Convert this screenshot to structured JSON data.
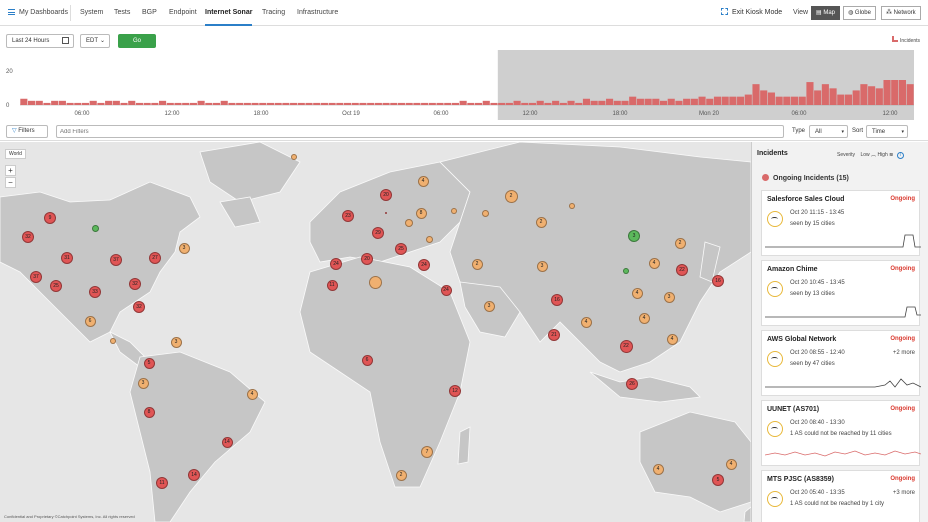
{
  "nav": {
    "dashboards": "My Dashboards",
    "tabs": [
      "System",
      "Tests",
      "BGP",
      "Endpoint",
      "Internet Sonar",
      "Tracing",
      "Infrastructure"
    ],
    "active": "Internet Sonar",
    "exit_kiosk": "Exit Kiosk Mode",
    "view_label": "View",
    "views": [
      "Map",
      "Globe",
      "Network"
    ],
    "selected_view": "Map"
  },
  "controls": {
    "range": "Last 24 Hours",
    "tz": "EDT",
    "go": "Go"
  },
  "histogram": {
    "legend": "Incidents",
    "y_ticks": [
      "20",
      "0"
    ],
    "x_ticks": [
      "06:00",
      "12:00",
      "18:00",
      "Oct 19",
      "06:00",
      "12:00",
      "18:00",
      "Mon 20",
      "06:00",
      "12:00"
    ],
    "values": [
      3,
      2,
      2,
      1,
      2,
      2,
      1,
      1,
      1,
      2,
      1,
      2,
      2,
      1,
      2,
      1,
      1,
      1,
      2,
      1,
      1,
      1,
      1,
      2,
      1,
      1,
      2,
      1,
      1,
      1,
      1,
      1,
      1,
      1,
      1,
      1,
      1,
      1,
      1,
      1,
      1,
      1,
      1,
      1,
      1,
      1,
      1,
      1,
      1,
      1,
      1,
      1,
      1,
      1,
      1,
      1,
      1,
      2,
      1,
      1,
      2,
      1,
      1,
      1,
      2,
      1,
      1,
      2,
      1,
      2,
      1,
      2,
      1,
      3,
      2,
      2,
      3,
      2,
      2,
      4,
      3,
      3,
      3,
      2,
      3,
      2,
      3,
      3,
      4,
      3,
      4,
      4,
      4,
      4,
      5,
      10,
      7,
      6,
      4,
      4,
      4,
      4,
      11,
      7,
      10,
      8,
      5,
      5,
      7,
      10,
      9,
      8,
      12,
      12,
      12,
      10
    ],
    "selected_from_index": 62
  },
  "filterbar": {
    "filters_btn": "Filters",
    "add_filters_placeholder": "Add Filters",
    "type_label": "Type",
    "type_value": "All",
    "sort_label": "Sort",
    "sort_value": "Time"
  },
  "map": {
    "world_label": "World",
    "zoom_in": "+",
    "zoom_out": "−",
    "markers": [
      {
        "v": "9",
        "c": "red"
      },
      {
        "v": "32",
        "c": "red"
      },
      {
        "v": "37",
        "c": "red"
      },
      {
        "v": "31",
        "c": "red"
      },
      {
        "v": "37",
        "c": "red"
      },
      {
        "v": "27",
        "c": "red"
      },
      {
        "v": "3",
        "c": "orange"
      },
      {
        "v": "25",
        "c": "red"
      },
      {
        "v": "33",
        "c": "red"
      },
      {
        "v": "32",
        "c": "red"
      },
      {
        "v": "32",
        "c": "red"
      },
      {
        "v": "6",
        "c": "orange"
      },
      {
        "v": "",
        "c": "green"
      },
      {
        "v": "",
        "c": "orange"
      },
      {
        "v": "3",
        "c": "orange"
      },
      {
        "v": "5",
        "c": "red"
      },
      {
        "v": "3",
        "c": "orange"
      },
      {
        "v": "8",
        "c": "red"
      },
      {
        "v": "4",
        "c": "orange"
      },
      {
        "v": "14",
        "c": "red"
      },
      {
        "v": "14",
        "c": "red"
      },
      {
        "v": "11",
        "c": "red"
      },
      {
        "v": "",
        "c": "orange"
      },
      {
        "v": "20",
        "c": "red"
      },
      {
        "v": "4",
        "c": "orange"
      },
      {
        "v": "23",
        "c": "red"
      },
      {
        "v": "",
        "c": "red"
      },
      {
        "v": "8",
        "c": "orange"
      },
      {
        "v": "",
        "c": "orange"
      },
      {
        "v": "",
        "c": "orange"
      },
      {
        "v": "29",
        "c": "red"
      },
      {
        "v": "",
        "c": "orange"
      },
      {
        "v": "25",
        "c": "red"
      },
      {
        "v": "24",
        "c": "red"
      },
      {
        "v": "20",
        "c": "red"
      },
      {
        "v": "24",
        "c": "red"
      },
      {
        "v": "11",
        "c": "red"
      },
      {
        "v": "",
        "c": "orange"
      },
      {
        "v": "2",
        "c": "orange"
      },
      {
        "v": "",
        "c": "orange"
      },
      {
        "v": "2",
        "c": "orange"
      },
      {
        "v": "",
        "c": "orange"
      },
      {
        "v": "2",
        "c": "orange"
      },
      {
        "v": "3",
        "c": "green"
      },
      {
        "v": "2",
        "c": "orange"
      },
      {
        "v": "3",
        "c": "orange"
      },
      {
        "v": "24",
        "c": "red"
      },
      {
        "v": "3",
        "c": "orange"
      },
      {
        "v": "16",
        "c": "red"
      },
      {
        "v": "21",
        "c": "red"
      },
      {
        "v": "4",
        "c": "orange"
      },
      {
        "v": "",
        "c": "green"
      },
      {
        "v": "4",
        "c": "orange"
      },
      {
        "v": "22",
        "c": "red"
      },
      {
        "v": "16",
        "c": "red"
      },
      {
        "v": "4",
        "c": "orange"
      },
      {
        "v": "3",
        "c": "orange"
      },
      {
        "v": "4",
        "c": "orange"
      },
      {
        "v": "4",
        "c": "orange"
      },
      {
        "v": "22",
        "c": "red"
      },
      {
        "v": "26",
        "c": "red"
      },
      {
        "v": "6",
        "c": "red"
      },
      {
        "v": "12",
        "c": "red"
      },
      {
        "v": "7",
        "c": "orange"
      },
      {
        "v": "2",
        "c": "orange"
      },
      {
        "v": "4",
        "c": "orange"
      },
      {
        "v": "5",
        "c": "red"
      },
      {
        "v": "4",
        "c": "orange"
      }
    ]
  },
  "panel": {
    "title": "Incidents",
    "severity_label": "Severity",
    "low": "Low",
    "high": "High",
    "ongoing_header": "Ongoing Incidents (15)",
    "cards": [
      {
        "title": "Salesforce Sales Cloud",
        "status": "Ongoing",
        "time": "Oct 20 11:15 - 13:45",
        "seen": "seen by 15 cities",
        "more": ""
      },
      {
        "title": "Amazon Chime",
        "status": "Ongoing",
        "time": "Oct 20 10:45 - 13:45",
        "seen": "seen by 13 cities",
        "more": ""
      },
      {
        "title": "AWS Global Network",
        "status": "Ongoing",
        "time": "Oct 20 08:55 - 12:40",
        "seen": "seen by 47 cities",
        "more": "+2 more"
      },
      {
        "title": "UUNET (AS701)",
        "status": "Ongoing",
        "time": "Oct 20 08:40 - 13:30",
        "seen": "1 AS could not be reached by 11 cities",
        "more": ""
      },
      {
        "title": "MTS PJSC (AS8359)",
        "status": "Ongoing",
        "time": "Oct 20 05:40 - 13:35",
        "seen": "1 AS could not be reached by 1 city",
        "more": "+3 more"
      }
    ]
  },
  "footer": {
    "text": "Confidential and Proprietary ©Catchpoint Systems, Inc. All rights reserved"
  },
  "colors": {
    "accent": "#2b7fc8",
    "bar": "#d96a6a",
    "go": "#3aa14a",
    "ongoing": "#d9372c"
  }
}
